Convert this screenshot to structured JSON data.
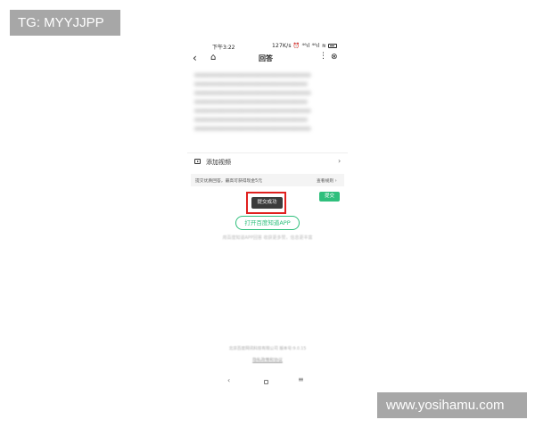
{
  "watermarks": {
    "top_left": "TG: MYYJJPP",
    "bottom_right": "www.yosihamu.com"
  },
  "status_bar": {
    "time": "下午3:22",
    "network": "127K/s ⏰ ⁴⁶ıl ⁴⁶ıl ≋"
  },
  "title_bar": {
    "back_icon": "‹",
    "home_icon": "⌂",
    "title": "回答",
    "more_icon": "⋮",
    "close_icon": "⊗"
  },
  "answer_text_blurred": [
    "xxxxxxxxxxxxxxxxxxxxxxxxxxxxxxxxxxx",
    "xxxxxxxxxxxxxxxxxxxxxxxxxxxxxxxxxx",
    "xxxxxxxxxxxxxxxxxxxxxxxxxxxxxxxxxxx",
    "xxxxxxxxxxxxxxxxxxxxxxxxxxxxxxxxxx",
    "xxxxxxxxxxxxxxxxxxxxxxxxxxxxxxxxxxx",
    "xxxxxxxxxxxxxxxxxxxxxxxxxxxxxxxxxx",
    "xxxxxxxxxxxxxxxxxxxxxxxxxxxxxxxxxxx"
  ],
  "add_video": {
    "label": "添加视频",
    "chevron": "›"
  },
  "reward_bar": {
    "text": "提交优质回答，最高可获得现金5元",
    "rule_link": "查看规则 ›"
  },
  "submit_button": "提交",
  "toast": "提交成功",
  "open_app_button": "打开百度知道APP",
  "hint_text": "用百度知道APP回答 收获更多赞，信息更丰富",
  "footer": {
    "line1": "北京百度网讯科技有限公司 版本号:9.0.15",
    "privacy_link": "隐私政策和协议"
  },
  "nav_bar": {
    "back": "‹",
    "menu": "≡"
  }
}
